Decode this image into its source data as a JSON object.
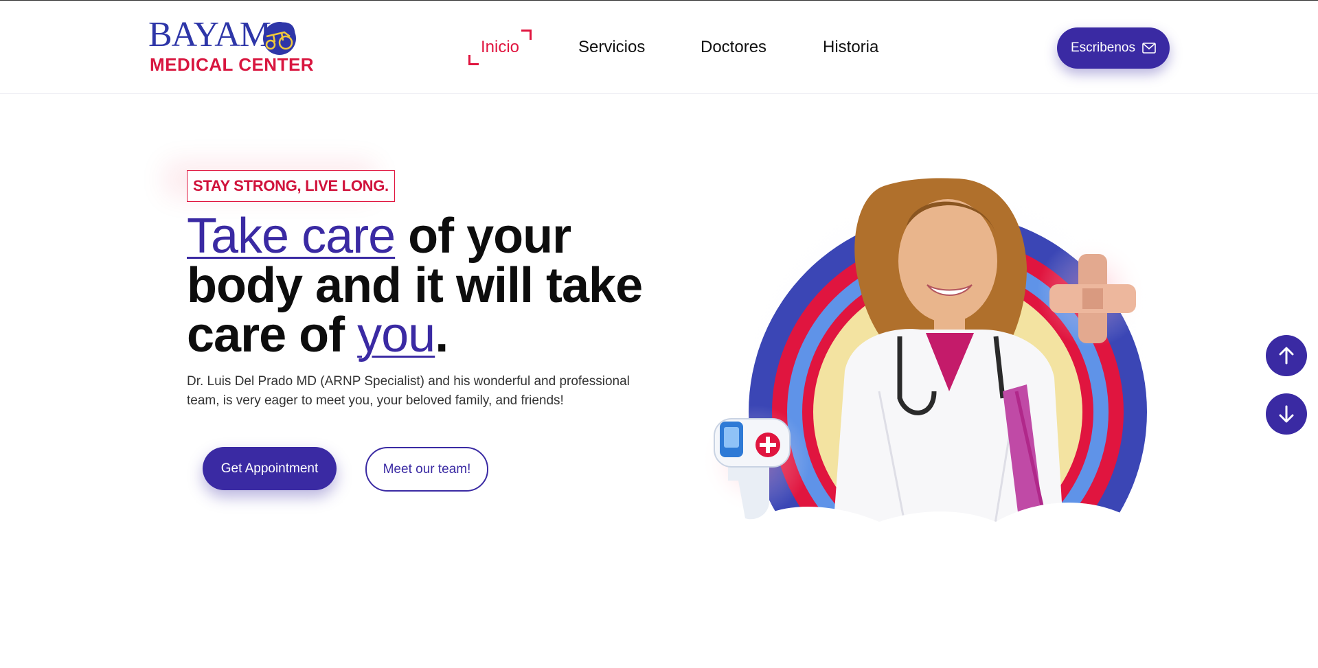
{
  "logo": {
    "brand": "BAYAMO",
    "subtitle": "MEDICAL CENTER"
  },
  "nav": {
    "items": [
      {
        "label": "Inicio",
        "active": true
      },
      {
        "label": "Servicios",
        "active": false
      },
      {
        "label": "Doctores",
        "active": false
      },
      {
        "label": "Historia",
        "active": false
      }
    ],
    "cta_label": "Escribenos",
    "cta_icon": "envelope-icon"
  },
  "hero": {
    "tagline": "STAY STRONG, LIVE LONG.",
    "headline_accent_1": "Take care",
    "headline_mid": " of your body and it will take care of ",
    "headline_accent_2": "you",
    "headline_end": ".",
    "description": "Dr. Luis Del Prado MD (ARNP Specialist) and his wonderful and professional team, is very eager to meet you, your beloved family, and friends!",
    "primary_button": "Get Appointment",
    "secondary_button": "Meet our team!"
  },
  "scroll": {
    "up_icon": "arrow-up-icon",
    "down_icon": "arrow-down-icon"
  },
  "colors": {
    "primary": "#3a2aa3",
    "accent_red": "#e0153f",
    "ring_blue": "#3b46b5",
    "ring_light_blue": "#5f93e8",
    "ring_yellow": "#f3e3a1"
  }
}
